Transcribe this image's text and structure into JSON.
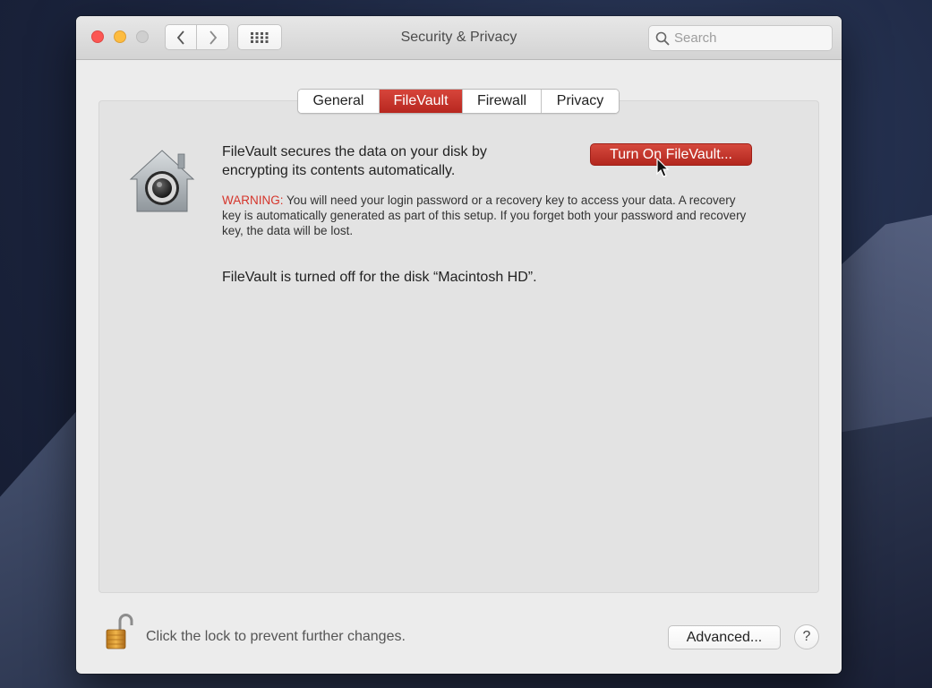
{
  "window": {
    "title": "Security & Privacy"
  },
  "toolbar": {
    "search_placeholder": "Search"
  },
  "tabs": [
    {
      "label": "General",
      "active": false
    },
    {
      "label": "FileVault",
      "active": true
    },
    {
      "label": "Firewall",
      "active": false
    },
    {
      "label": "Privacy",
      "active": false
    }
  ],
  "filevault": {
    "description": "FileVault secures the data on your disk by encrypting its contents automatically.",
    "turn_on_label": "Turn On FileVault...",
    "warning_label": "WARNING:",
    "warning_text": " You will need your login password or a recovery key to access your data. A recovery key is automatically generated as part of this setup. If you forget both your password and recovery key, the data will be lost.",
    "status": "FileVault is turned off for the disk “Macintosh HD”."
  },
  "footer": {
    "lock_text": "Click the lock to prevent further changes.",
    "advanced_label": "Advanced...",
    "help_label": "?"
  },
  "colors": {
    "accent": "#c3332a",
    "warning": "#d5352b",
    "close": "#fc5753",
    "minimize": "#fdbc40"
  }
}
